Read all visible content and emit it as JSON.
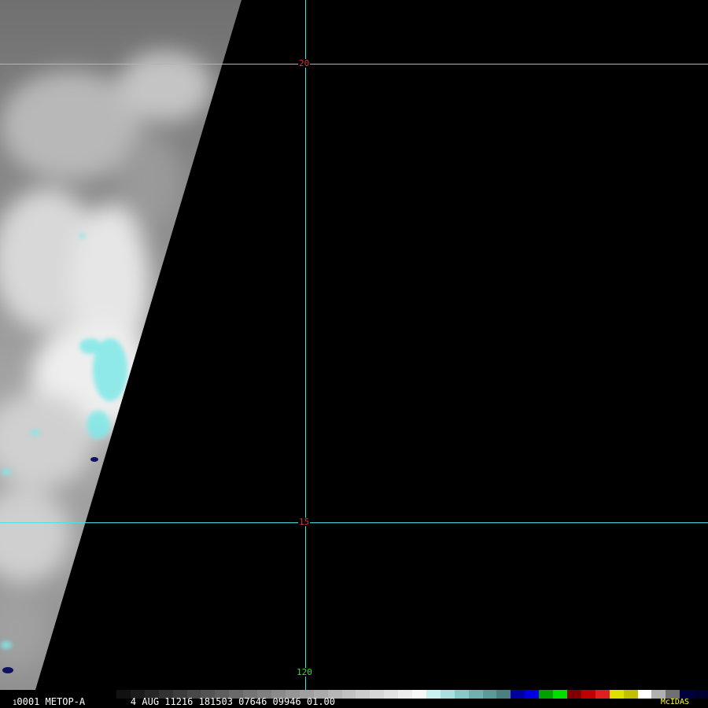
{
  "colors": {
    "grid": "#4ee0e0",
    "lat_label": "#e03030",
    "lon_label": "#30e030",
    "brand": "#ffff40",
    "background": "#000000",
    "cold_cloud": "#7fe8e8"
  },
  "grid": {
    "lat_lines": [
      {
        "label": "20"
      },
      {
        "label": "15"
      }
    ],
    "lon_lines": [
      {
        "label": "120"
      }
    ]
  },
  "status_bar": {
    "frame_prefix": "1",
    "frame_info": "0001 METOP-A        4 AUG 11216 181503 07646 09946 01.00",
    "brand": "McIDAS"
  },
  "colorbar": [
    "#111111",
    "#1c1c1c",
    "#272727",
    "#323232",
    "#3d3d3d",
    "#484848",
    "#535353",
    "#5e5e5e",
    "#696969",
    "#747474",
    "#7f7f7f",
    "#8a8a8a",
    "#959595",
    "#a0a0a0",
    "#ababab",
    "#b6b6b6",
    "#c1c1c1",
    "#cccccc",
    "#d7d7d7",
    "#e2e2e2",
    "#ededed",
    "#f8f8f8",
    "#c8f2f2",
    "#a8e0e0",
    "#88c8c8",
    "#70b0b0",
    "#5a9a9a",
    "#4a8080",
    "#0000a0",
    "#0000e0",
    "#00a000",
    "#00e000",
    "#800000",
    "#c00000",
    "#e02020",
    "#e0e000",
    "#c0c000",
    "#ffffff",
    "#b0b0b0",
    "#707070",
    "#000040",
    "#000030"
  ]
}
